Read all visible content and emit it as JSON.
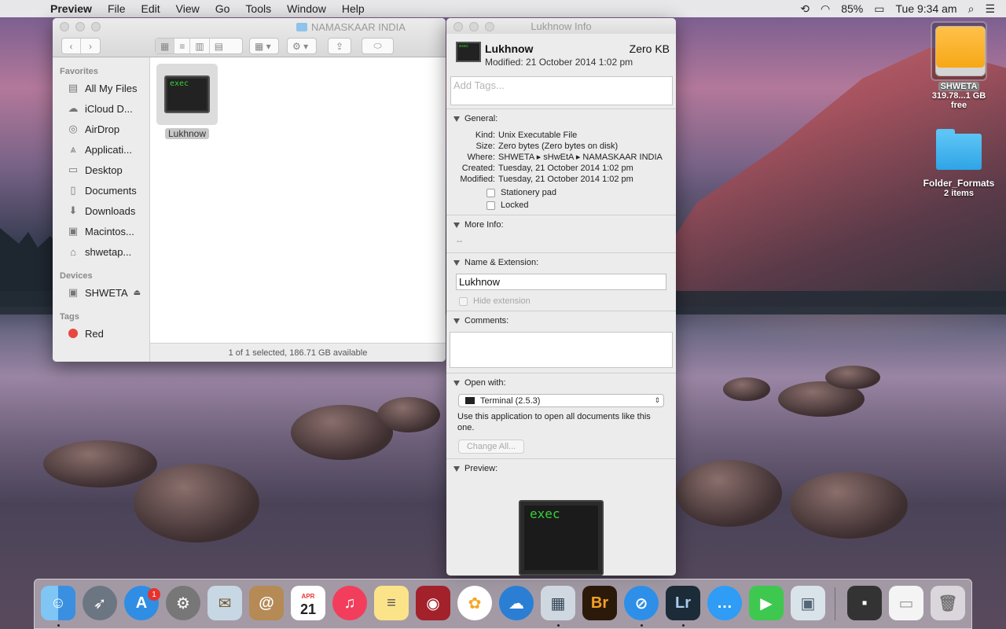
{
  "menubar": {
    "app": "Preview",
    "items": [
      "File",
      "Edit",
      "View",
      "Go",
      "Tools",
      "Window",
      "Help"
    ],
    "battery": "85%",
    "clock": "Tue 9:34 am"
  },
  "finder": {
    "title": "NAMASKAAR INDIA",
    "sidebar": {
      "favorites_heading": "Favorites",
      "favorites": [
        {
          "label": "All My Files",
          "icon": "all-files-icon"
        },
        {
          "label": "iCloud D...",
          "icon": "cloud-icon"
        },
        {
          "label": "AirDrop",
          "icon": "airdrop-icon"
        },
        {
          "label": "Applicati...",
          "icon": "applications-icon"
        },
        {
          "label": "Desktop",
          "icon": "desktop-icon"
        },
        {
          "label": "Documents",
          "icon": "documents-icon"
        },
        {
          "label": "Downloads",
          "icon": "downloads-icon"
        },
        {
          "label": "Macintos...",
          "icon": "hard-drive-icon"
        },
        {
          "label": "shwetap...",
          "icon": "home-icon"
        }
      ],
      "devices_heading": "Devices",
      "devices": [
        {
          "label": "SHWETA",
          "icon": "drive-icon"
        }
      ],
      "tags_heading": "Tags",
      "tags": [
        {
          "label": "Red",
          "color": "#e8463f"
        }
      ]
    },
    "file": {
      "name": "Lukhnow",
      "icon_text": "exec"
    },
    "status": "1 of 1 selected, 186.71 GB available"
  },
  "info": {
    "title": "Lukhnow Info",
    "name": "Lukhnow",
    "size": "Zero KB",
    "modified_line": "Modified: 21 October 2014 1:02 pm",
    "tags_placeholder": "Add Tags...",
    "general": {
      "heading": "General:",
      "rows": [
        {
          "k": "Kind:",
          "v": "Unix Executable File"
        },
        {
          "k": "Size:",
          "v": "Zero bytes (Zero bytes on disk)"
        },
        {
          "k": "Where:",
          "v": "SHWETA ▸ sHwEtA ▸ NAMASKAAR INDIA"
        },
        {
          "k": "Created:",
          "v": "Tuesday, 21 October 2014 1:02 pm"
        },
        {
          "k": "Modified:",
          "v": "Tuesday, 21 October 2014 1:02 pm"
        }
      ],
      "stationery": "Stationery pad",
      "locked": "Locked"
    },
    "more_info": {
      "heading": "More Info:",
      "value": "--"
    },
    "name_ext": {
      "heading": "Name & Extension:",
      "value": "Lukhnow",
      "hide_ext": "Hide extension"
    },
    "comments": {
      "heading": "Comments:"
    },
    "open_with": {
      "heading": "Open with:",
      "app": "Terminal (2.5.3)",
      "hint": "Use this application to open all documents like this one.",
      "change_all": "Change All..."
    },
    "preview": {
      "heading": "Preview:",
      "text": "exec"
    }
  },
  "desktop": {
    "drive": {
      "label": "SHWETA",
      "sub": "319.78...1 GB free"
    },
    "folder": {
      "label": "Folder_Formats",
      "sub": "2 items"
    }
  },
  "dock": {
    "calendar_month": "APR",
    "calendar_day": "21",
    "appstore_badge": "1",
    "bridge": "Br",
    "lightroom": "Lr"
  }
}
